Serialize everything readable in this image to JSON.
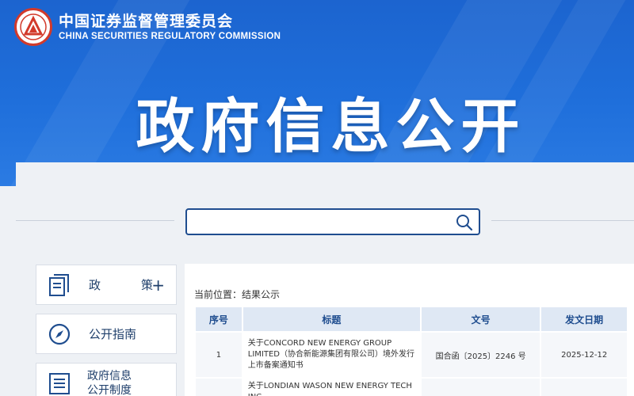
{
  "header": {
    "org_name_cn": "中国证券监督管理委员会",
    "org_name_en": "CHINA SECURITIES REGULATORY COMMISSION",
    "logo_icon": "csrc-emblem-icon",
    "hero_title": "政府信息公开",
    "colors": {
      "banner": "#1f6fdb",
      "emblem_ring": "#d23a2b"
    }
  },
  "search": {
    "value": "",
    "placeholder": "",
    "icon": "search-icon"
  },
  "sidebar": {
    "items": [
      {
        "label": "政　策",
        "icon": "document-stack-icon",
        "expand": "+"
      },
      {
        "label": "公开指南",
        "icon": "compass-icon"
      },
      {
        "label_line1": "政府信息",
        "label_line2": "公开制度",
        "icon": "list-document-icon"
      }
    ]
  },
  "main": {
    "breadcrumb": "当前位置：结果公示",
    "table": {
      "headers": [
        "序号",
        "标题",
        "文号",
        "发文日期"
      ],
      "rows": [
        {
          "index": "1",
          "title": "关于CONCORD NEW ENERGY GROUP LIMITED（协合新能源集团有限公司）境外发行上市备案通知书",
          "doc_no": "国合函〔2025〕2246 号",
          "date": "2025-12-12"
        },
        {
          "index": "",
          "title": "关于LONDIAN WASON NEW ENERGY TECH INC.",
          "doc_no": "",
          "date": ""
        }
      ]
    }
  }
}
